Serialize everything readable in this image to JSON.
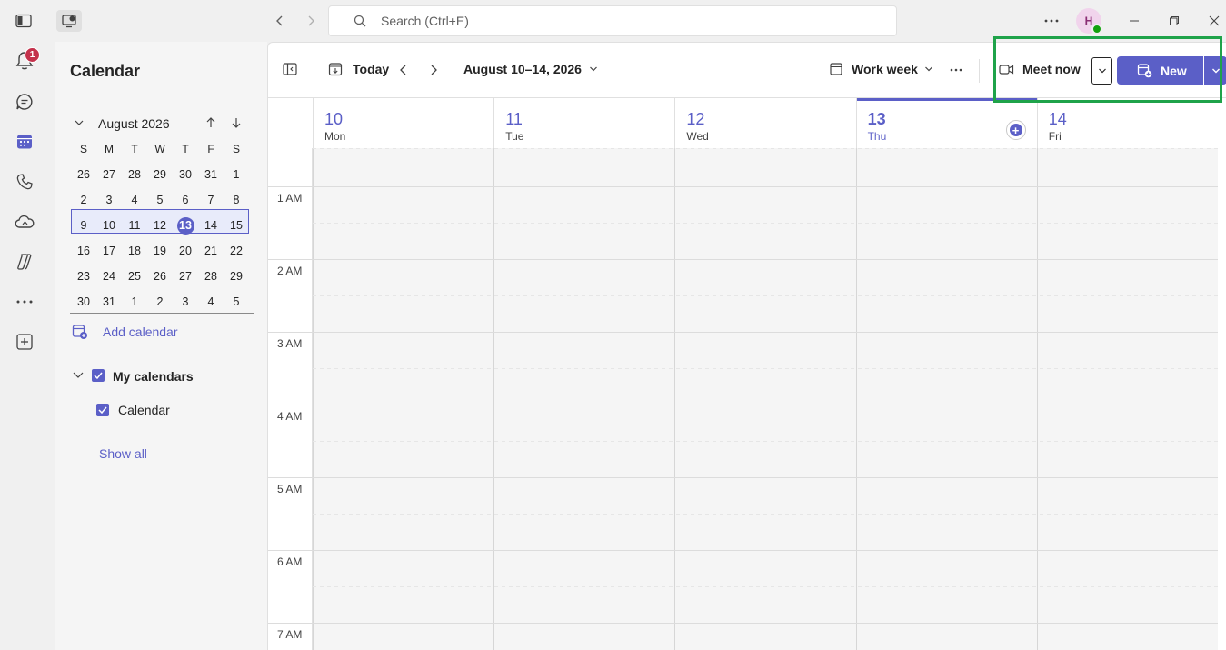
{
  "titlebar": {
    "search_placeholder": "Search (Ctrl+E)",
    "avatar_initial": "H"
  },
  "rail": {
    "notification_count": "1"
  },
  "sidebar": {
    "title": "Calendar",
    "mini_calendar": {
      "month_label": "August 2026",
      "weekday_headers": [
        "S",
        "M",
        "T",
        "W",
        "T",
        "F",
        "S"
      ],
      "weeks": [
        [
          "26",
          "27",
          "28",
          "29",
          "30",
          "31",
          "1"
        ],
        [
          "2",
          "3",
          "4",
          "5",
          "6",
          "7",
          "8"
        ],
        [
          "9",
          "10",
          "11",
          "12",
          "13",
          "14",
          "15"
        ],
        [
          "16",
          "17",
          "18",
          "19",
          "20",
          "21",
          "22"
        ],
        [
          "23",
          "24",
          "25",
          "26",
          "27",
          "28",
          "29"
        ],
        [
          "30",
          "31",
          "1",
          "2",
          "3",
          "4",
          "5"
        ]
      ],
      "today": "13"
    },
    "add_calendar_label": "Add calendar",
    "my_calendars_label": "My calendars",
    "calendar_item_label": "Calendar",
    "show_all_label": "Show all"
  },
  "toolbar": {
    "today_label": "Today",
    "date_range": "August 10–14, 2026",
    "view_label": "Work week",
    "meet_now_label": "Meet now",
    "new_label": "New"
  },
  "days": [
    {
      "num": "10",
      "name": "Mon"
    },
    {
      "num": "11",
      "name": "Tue"
    },
    {
      "num": "12",
      "name": "Wed"
    },
    {
      "num": "13",
      "name": "Thu"
    },
    {
      "num": "14",
      "name": "Fri"
    }
  ],
  "time_labels": [
    "1 AM",
    "2 AM",
    "3 AM",
    "4 AM",
    "5 AM",
    "6 AM",
    "7 AM"
  ],
  "colors": {
    "accent": "#5b5fc7",
    "highlight_box": "#1fa34a",
    "badge": "#c4314b"
  }
}
